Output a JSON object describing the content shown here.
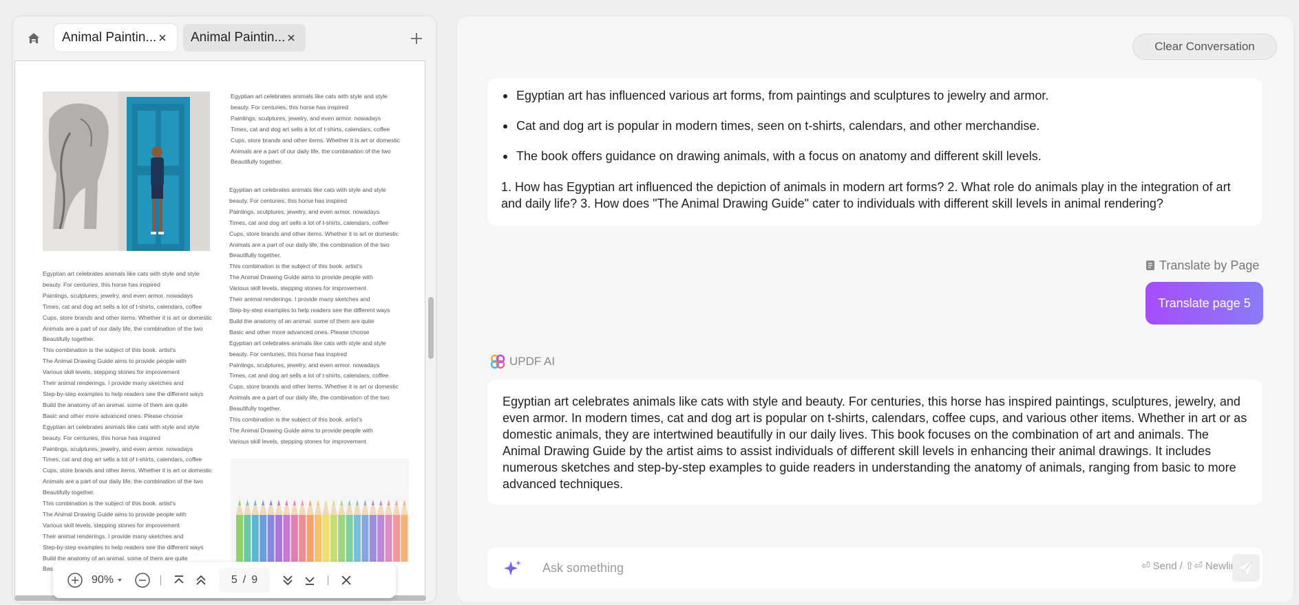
{
  "left_panel": {
    "tabs": [
      {
        "label": "Animal Paintin...",
        "active": true
      },
      {
        "label": "Animal Paintin...",
        "active": false
      }
    ],
    "document": {
      "column_a": [
        "Egyptian art celebrates animals like cats with style and style",
        "beauty. For centuries, this horse has inspired",
        "Paintings, sculptures, jewelry, and even armor. nowadays",
        "Times, cat and dog art sells a lot of t-shirts, calendars, coffee",
        "Cups, store brands and other items. Whether it is art or domestic",
        "Animals are a part of our daily life, the combination of the two",
        "Beautifully together."
      ],
      "column_b": [
        "Egyptian art celebrates animals like cats with style and style",
        "beauty. For centuries, this horse has inspired",
        "Paintings, sculptures, jewelry, and even armor. nowadays",
        "Times, cat and dog art sells a lot of t-shirts, calendars, coffee",
        "Cups, store brands and other items. Whether it is art or domestic",
        "Animals are a part of our daily life, the combination of the two",
        "Beautifully together.",
        "This combination is the subject of this book. artist's",
        "The Animal Drawing Guide aims to provide people with",
        "Various skill levels, stepping stones for improvement",
        "Their animal renderings. I provide many sketches and",
        "Step-by-step examples to help readers see the different ways",
        "Build the anatomy of an animal. some of them are quite",
        "Basic and other more advanced ones. Please choose",
        "Egyptian art celebrates animals like cats with style and style",
        "beauty. For centuries, this horse has inspired",
        "Paintings, sculptures, jewelry, and even armor. nowadays",
        "Times, cat and dog art sells a lot of t-shirts, calendars, coffee",
        "Cups, store brands and other items. Whether it is art or domestic",
        "Animals are a part of our daily life, the combination of the two",
        "Beautifully together.",
        "This combination is the subject of this book. artist's",
        "The Animal Drawing Guide aims to provide people with",
        "Various skill levels, stepping stones for improvement"
      ],
      "column_c": [
        "Egyptian art celebrates animals like cats with style and style",
        "beauty. For centuries, this horse has inspired",
        "Paintings, sculptures, jewelry, and even armor. nowadays",
        "Times, cat and dog art sells a lot of t-shirts, calendars, coffee",
        "Cups, store brands and other items. Whether it is art or domestic",
        "Animals are a part of our daily life, the combination of the two",
        "Beautifully together.",
        "This combination is the subject of this book. artist's",
        "The Animal Drawing Guide aims to provide people with",
        "Various skill levels, stepping stones for improvement",
        "Their animal renderings. I provide many sketches and",
        "Step-by-step examples to help readers see the different ways",
        "Build the anatomy of an animal. some of them are quite",
        "Basic and other more advanced ones. Please choose",
        "Egyptian art celebrates animals like cats with style and style",
        "beauty. For centuries, this horse has inspired",
        "Paintings, sculptures, jewelry, and even armor. nowadays",
        "Times, cat and dog art sells a lot of t-shirts, calendars, coffee",
        "Cups, store brands and other items. Whether it is art or domestic",
        "Animals are a part of our daily life, the combination of the two",
        "Beautifully together.",
        "This combination is the subject of this book. artist's",
        "The Animal Drawing Guide aims to provide people with",
        "Various skill levels, stepping stones for improvement",
        "Their animal renderings. I provide many sketches and",
        "Step-by-step examples to help readers see the different ways",
        "Build the anatomy of an animal. some of them are quite",
        "Bas"
      ]
    },
    "toolbar": {
      "zoom": "90%",
      "current_page": "5",
      "page_separator": "/",
      "total_pages": "9"
    }
  },
  "chat": {
    "clear_label": "Clear Conversation",
    "answer_bullets": [
      "Egyptian art has influenced various art forms, from paintings and sculptures to jewelry and armor.",
      "Cat and dog art is popular in modern times, seen on t-shirts, calendars, and other merchandise.",
      "The book offers guidance on drawing animals, with a focus on anatomy and different skill levels."
    ],
    "answer_questions": "1. How has Egyptian art influenced the depiction of animals in modern art forms? 2. What role do animals play in the integration of art and daily life? 3. How does \"The Animal Drawing Guide\" cater to individuals with different skill levels in animal rendering?",
    "user_action_label": "Translate by Page",
    "user_message": "Translate page 5",
    "assistant_name": "UPDF AI",
    "assistant_reply": "Egyptian art celebrates animals like cats with style and beauty. For centuries, this horse has inspired paintings, sculptures, jewelry, and even armor. In modern times, cat and dog art is popular on t-shirts, calendars, coffee cups, and various other items. Whether in art or as domestic animals, they are intertwined beautifully in our daily lives. This book focuses on the combination of art and animals. The Animal Drawing Guide by the artist aims to assist individuals of different skill levels in enhancing their animal drawings. It includes numerous sketches and step-by-step examples to guide readers in understanding the anatomy of animals, ranging from basic to more advanced techniques.",
    "input": {
      "placeholder": "Ask something",
      "value": "",
      "send_hint": "Send",
      "hint_separator": "/",
      "newline_hint": "Newline"
    }
  },
  "colors": {
    "accent_gradient_start": "#a64dfa",
    "accent_gradient_end": "#8a7cf7",
    "panel_bg": "#f6f6f6",
    "card_bg": "#ffffff"
  }
}
